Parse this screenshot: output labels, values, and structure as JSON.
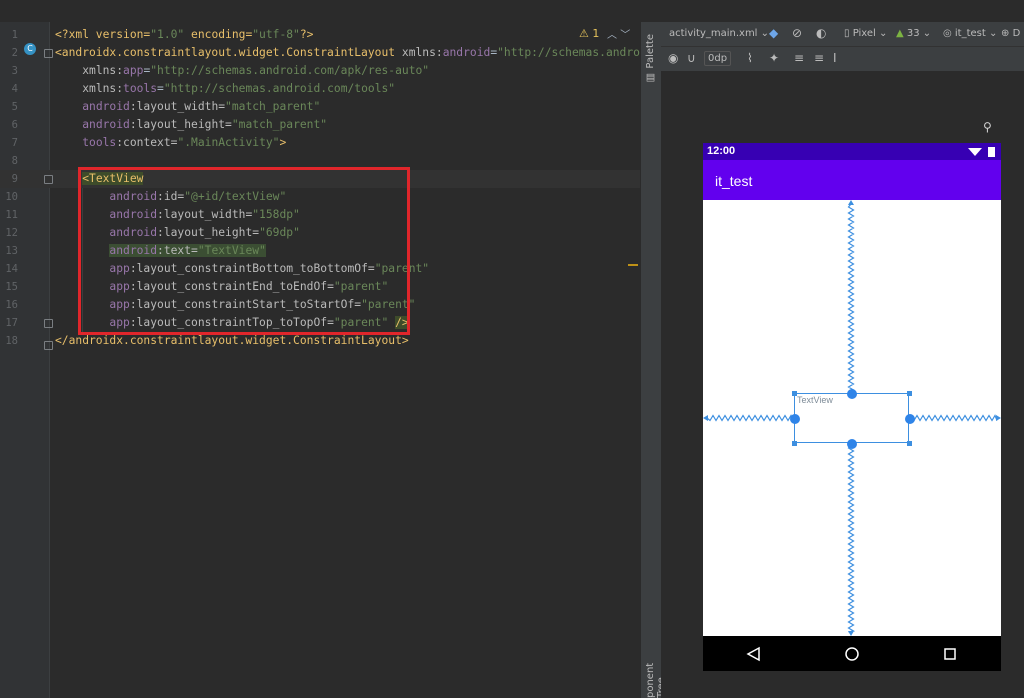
{
  "editor": {
    "lines": [
      {
        "n": "1",
        "html": "<span class=\"pi\">&lt;?xml version=</span><span class=\"str\">\"1.0\"</span><span class=\"pi\"> encoding=</span><span class=\"str\">\"utf-8\"</span><span class=\"pi\">?&gt;</span>"
      },
      {
        "n": "2",
        "html": "<span class=\"tag\">&lt;androidx.constraintlayout.widget.ConstraintLayout</span> <span class=\"attr\">xmlns:</span><span class=\"ns\">android</span>=<span class=\"str\">\"http://schemas.android</span>"
      },
      {
        "n": "3",
        "html": "    <span class=\"attr\">xmlns:</span><span class=\"ns\">app</span>=<span class=\"str\">\"http://schemas.android.com/apk/res-auto\"</span>"
      },
      {
        "n": "4",
        "html": "    <span class=\"attr\">xmlns:</span><span class=\"ns\">tools</span>=<span class=\"str\">\"http://schemas.android.com/tools\"</span>"
      },
      {
        "n": "5",
        "html": "    <span class=\"ns\">android</span><span class=\"attr\">:layout_width=</span><span class=\"str\">\"match_parent\"</span>"
      },
      {
        "n": "6",
        "html": "    <span class=\"ns\">android</span><span class=\"attr\">:layout_height=</span><span class=\"str\">\"match_parent\"</span>"
      },
      {
        "n": "7",
        "html": "    <span class=\"ns\">tools</span><span class=\"attr\">:context=</span><span class=\"str\">\".MainActivity\"</span><span class=\"tag\">&gt;</span>"
      },
      {
        "n": "8",
        "html": ""
      },
      {
        "n": "9",
        "html": "    <span class=\"tag hl2\">&lt;TextView</span>"
      },
      {
        "n": "10",
        "html": "        <span class=\"ns\">android</span><span class=\"attr\">:id=</span><span class=\"str\">\"@+id/textView\"</span>"
      },
      {
        "n": "11",
        "html": "        <span class=\"ns\">android</span><span class=\"attr\">:layout_width=</span><span class=\"str\">\"158dp\"</span>"
      },
      {
        "n": "12",
        "html": "        <span class=\"ns\">android</span><span class=\"attr\">:layout_height=</span><span class=\"str\">\"69dp\"</span>"
      },
      {
        "n": "13",
        "html": "        <span class=\"hl\"><span class=\"ns\">android</span><span class=\"attr\">:text=</span><span class=\"str\">\"TextView\"</span></span>"
      },
      {
        "n": "14",
        "html": "        <span class=\"ns\">app</span><span class=\"attr\">:layout_constraintBottom_toBottomOf=</span><span class=\"str\">\"parent\"</span>"
      },
      {
        "n": "15",
        "html": "        <span class=\"ns\">app</span><span class=\"attr\">:layout_constraintEnd_toEndOf=</span><span class=\"str\">\"parent\"</span>"
      },
      {
        "n": "16",
        "html": "        <span class=\"ns\">app</span><span class=\"attr\">:layout_constraintStart_toStartOf=</span><span class=\"str\">\"parent\"</span>"
      },
      {
        "n": "17",
        "html": "        <span class=\"ns\">app</span><span class=\"attr\">:layout_constraintTop_toTopOf=</span><span class=\"str\">\"parent\"</span> <span class=\"tag hl2\">/&gt;</span>"
      },
      {
        "n": "18",
        "html": "<span class=\"tag\">&lt;/androidx.constraintlayout.widget.ConstraintLayout&gt;</span>"
      }
    ],
    "warning_count": "1",
    "class_badge": "C"
  },
  "side_tabs": {
    "palette": "Palette",
    "component_tree": "ponent Tree"
  },
  "toolbar": {
    "file_name": "activity_main.xml",
    "device": "Pixel",
    "api": "33",
    "theme": "it_test",
    "margin": "0dp",
    "overflow": "D"
  },
  "phone": {
    "time": "12:00",
    "app_title": "it_test",
    "textview_text": "TextView"
  },
  "colors": {
    "status_bar": "#3700b3",
    "app_bar": "#6200ee",
    "selection": "#2f84e8",
    "red_box": "#e0262b"
  }
}
